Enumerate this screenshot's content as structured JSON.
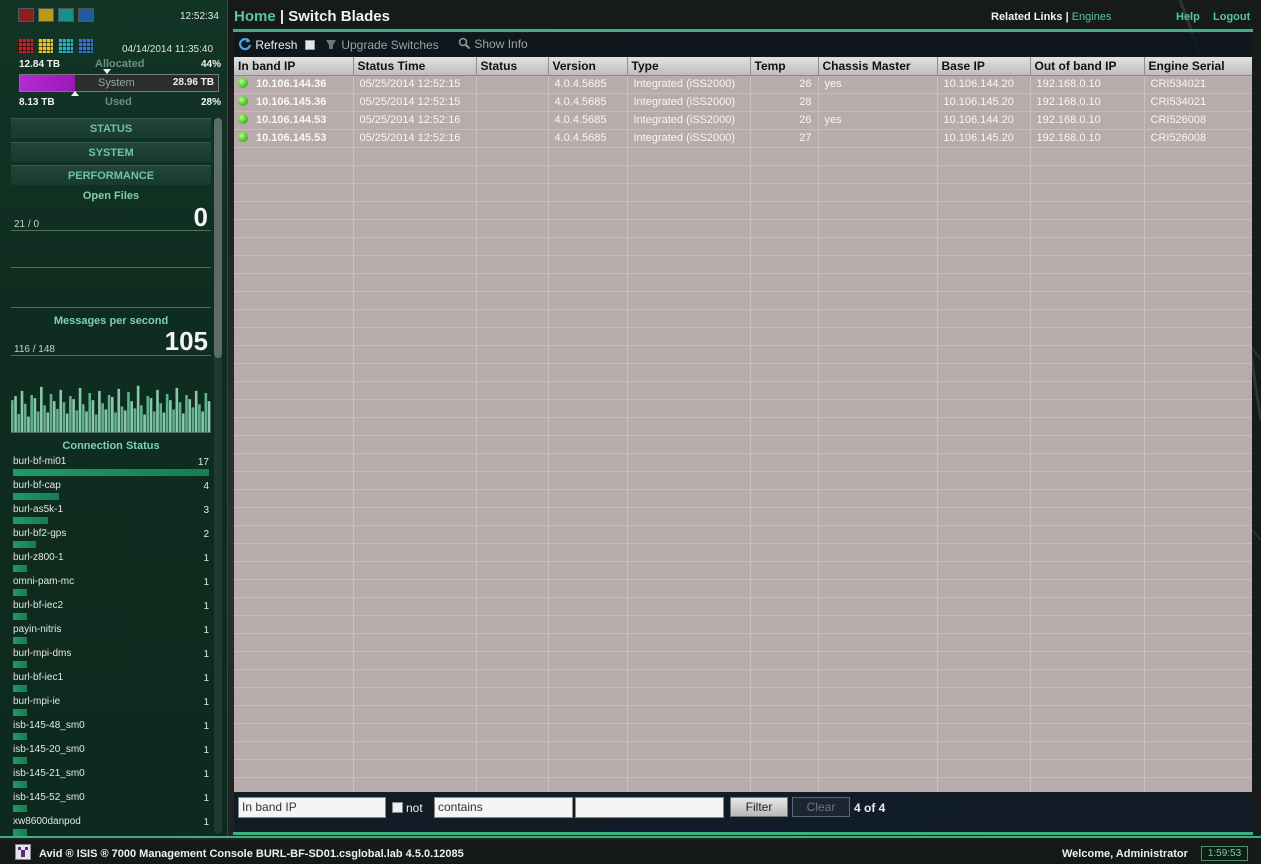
{
  "colors": {
    "accent": "#58c79a",
    "allocated_purple": "#b52ad4",
    "grid_bg": "#b7acab",
    "status_green": "#39b81b"
  },
  "app_squares": [
    {
      "name": "red-square-icon",
      "color": "#8b1f1f"
    },
    {
      "name": "yellow-square-icon",
      "color": "#b69c1a"
    },
    {
      "name": "teal-square-icon",
      "color": "#1a8d8d"
    },
    {
      "name": "blue-square-icon",
      "color": "#1f5ba0"
    }
  ],
  "raid_icons": [
    {
      "name": "raid-red-icon",
      "color": "#d11f1f"
    },
    {
      "name": "raid-yellow-icon",
      "color": "#e0cf1c"
    },
    {
      "name": "raid-teal-icon",
      "color": "#19b9c4"
    },
    {
      "name": "raid-blue-icon",
      "color": "#2d75d6"
    }
  ],
  "status": {
    "clock": "12:52:34",
    "date": "04/14/2014 11:35:40",
    "allocated_size": "12.84 TB",
    "allocated_label": "Allocated",
    "allocated_pct": "44%",
    "system_label": "System",
    "system_total": "28.96 TB",
    "used_size": "8.13 TB",
    "used_label": "Used",
    "used_pct": "28%",
    "allocated_fraction": 0.44,
    "used_fraction": 0.28
  },
  "nav": {
    "status": "STATUS",
    "system": "SYSTEM",
    "performance": "PERFORMANCE"
  },
  "open_files": {
    "title": "Open Files",
    "value": "0",
    "ratio": "21 / 0"
  },
  "messages": {
    "title": "Messages per second",
    "value": "105",
    "ratio": "116 / 148",
    "max": 148,
    "history": [
      62,
      70,
      35,
      80,
      55,
      30,
      72,
      66,
      40,
      88,
      52,
      38,
      74,
      60,
      45,
      82,
      58,
      36,
      70,
      64,
      42,
      86,
      54,
      40,
      76,
      62,
      34,
      80,
      56,
      44,
      72,
      68,
      38,
      84,
      50,
      42,
      78,
      60,
      46,
      90,
      52,
      34,
      70,
      66,
      40,
      82,
      56,
      38,
      74,
      62,
      44,
      86,
      58,
      36,
      72,
      64,
      48,
      80,
      54,
      40,
      76,
      60
    ]
  },
  "connections": {
    "title": "Connection Status",
    "max": 17,
    "items": [
      {
        "name": "burl-bf-mi01",
        "count": 17
      },
      {
        "name": "burl-bf-cap",
        "count": 4
      },
      {
        "name": "burl-as5k-1",
        "count": 3
      },
      {
        "name": "burl-bf2-gps",
        "count": 2
      },
      {
        "name": "burl-z800-1",
        "count": 1
      },
      {
        "name": "omni-pam-mc",
        "count": 1
      },
      {
        "name": "burl-bf-iec2",
        "count": 1
      },
      {
        "name": "payin-nitris",
        "count": 1
      },
      {
        "name": "burl-mpi-dms",
        "count": 1
      },
      {
        "name": "burl-bf-iec1",
        "count": 1
      },
      {
        "name": "burl-mpi-ie",
        "count": 1
      },
      {
        "name": "isb-145-48_sm0",
        "count": 1
      },
      {
        "name": "isb-145-20_sm0",
        "count": 1
      },
      {
        "name": "isb-145-21_sm0",
        "count": 1
      },
      {
        "name": "isb-145-52_sm0",
        "count": 1
      },
      {
        "name": "xw8600danpod",
        "count": 1
      }
    ]
  },
  "header": {
    "home": "Home",
    "separator": " | ",
    "page": "Switch Blades",
    "related_label": "Related Links |",
    "related_link": "Engines",
    "help": "Help",
    "logout": "Logout"
  },
  "toolbar": {
    "refresh": "Refresh",
    "upgrade": "Upgrade Switches",
    "show_info": "Show Info"
  },
  "table": {
    "columns": [
      "In band IP",
      "Status Time",
      "Status",
      "Version",
      "Type",
      "Temp",
      "Chassis Master",
      "Base IP",
      "Out of band IP",
      "Engine Serial"
    ],
    "rows": [
      {
        "in_band_ip": "10.106.144.36",
        "status_time": "05/25/2014 12:52:15",
        "status": "",
        "version": "4.0.4.5685",
        "type": "Integrated (iSS2000)",
        "temp": "26",
        "chassis_master": "yes",
        "base_ip": "10.106.144.20",
        "oob_ip": "192.168.0.10",
        "engine_serial": "CRI534021"
      },
      {
        "in_band_ip": "10.106.145.36",
        "status_time": "05/25/2014 12:52:15",
        "status": "",
        "version": "4.0.4.5685",
        "type": "Integrated (iSS2000)",
        "temp": "28",
        "chassis_master": "",
        "base_ip": "10.106.145.20",
        "oob_ip": "192.168.0.10",
        "engine_serial": "CRI534021"
      },
      {
        "in_band_ip": "10.106.144.53",
        "status_time": "05/25/2014 12:52:16",
        "status": "",
        "version": "4.0.4.5685",
        "type": "Integrated (iSS2000)",
        "temp": "26",
        "chassis_master": "yes",
        "base_ip": "10.106.144.20",
        "oob_ip": "192.168.0.10",
        "engine_serial": "CRI526008"
      },
      {
        "in_band_ip": "10.106.145.53",
        "status_time": "05/25/2014 12:52:16",
        "status": "",
        "version": "4.0.4.5685",
        "type": "Integrated (iSS2000)",
        "temp": "27",
        "chassis_master": "",
        "base_ip": "10.106.145.20",
        "oob_ip": "192.168.0.10",
        "engine_serial": "CRI526008"
      }
    ]
  },
  "filter": {
    "field": "In band IP",
    "not_label": "not",
    "operator": "contains",
    "value": "",
    "filter_button": "Filter",
    "clear_button": "Clear",
    "count": "4 of 4"
  },
  "footer": {
    "title": "Avid ® ISIS ® 7000  Management Console  BURL-BF-SD01.csglobal.lab  4.5.0.12085",
    "welcome": "Welcome, Administrator",
    "timer": "1:59:53"
  }
}
